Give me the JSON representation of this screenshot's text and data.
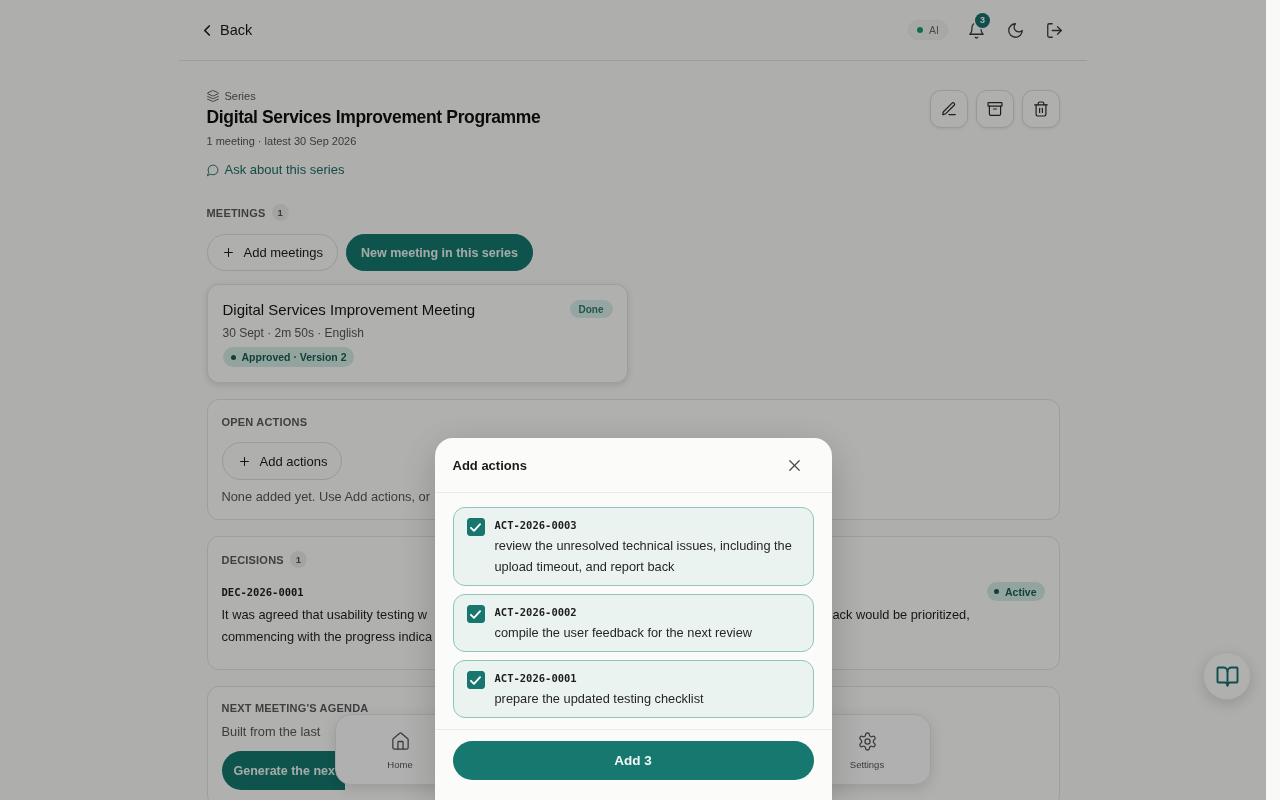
{
  "topbar": {
    "back": "Back",
    "ai_chip": {
      "label": "AI",
      "on": true
    },
    "notifications": {
      "count": "3"
    }
  },
  "series": {
    "eyebrow": "Series",
    "title": "Digital Services Improvement Programme",
    "meta": "1 meeting · latest 30 Sep 2026",
    "ask_link": "Ask about this series"
  },
  "meetings": {
    "heading": "MEETINGS",
    "count": "1",
    "buttons": [
      {
        "label": "Add meetings",
        "kind": "secondary"
      },
      {
        "label": "New meeting in this series",
        "kind": "primary"
      }
    ],
    "cards": [
      {
        "title": "Digital Services Improvement Meeting",
        "status": "Done",
        "meta": "30 Sept · 2m 50s · English",
        "approval": "Approved · Version 2"
      }
    ]
  },
  "open_actions": {
    "heading": "OPEN ACTIONS",
    "add_button": "Add actions",
    "note": "None added yet. Use Add actions, or"
  },
  "decisions": {
    "heading": "DECISIONS",
    "count": "1",
    "items": [
      {
        "id": "DEC-2026-0001",
        "status": "Active",
        "text_visible_left": "It was agreed that usability testing w\ncommencing with the progress indica",
        "text_visible_right": "ack would be prioritized,"
      }
    ]
  },
  "agenda": {
    "heading": "NEXT MEETING'S AGENDA",
    "note": "Built from the last",
    "generate_button": "Generate the nex"
  },
  "bottom_nav": {
    "items": [
      {
        "label": "Home",
        "selected": false
      },
      {
        "label": "Settings",
        "selected": false
      }
    ]
  },
  "modal": {
    "title": "Add actions",
    "items": [
      {
        "id": "ACT-2026-0003",
        "text": "review the unresolved technical issues, including the upload timeout, and report back",
        "checked": true
      },
      {
        "id": "ACT-2026-0002",
        "text": "compile the user feedback for the next review",
        "checked": true
      },
      {
        "id": "ACT-2026-0001",
        "text": "prepare the updated testing checklist",
        "checked": true
      }
    ],
    "confirm_button": "Add 3"
  }
}
